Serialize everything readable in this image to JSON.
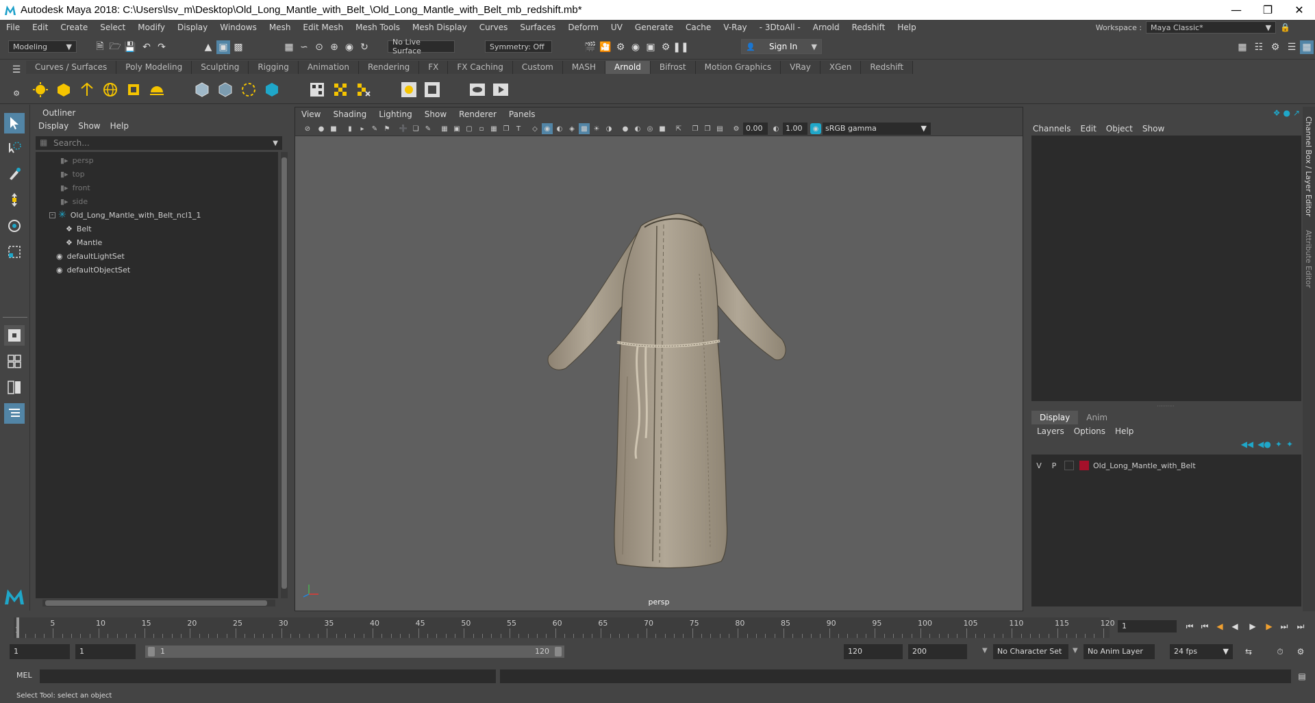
{
  "window": {
    "title": "Autodesk Maya 2018: C:\\Users\\lsv_m\\Desktop\\Old_Long_Mantle_with_Belt_\\Old_Long_Mantle_with_Belt_mb_redshift.mb*",
    "minimize_icon": "minimize-icon",
    "restore_icon": "restore-icon",
    "close_icon": "close-icon"
  },
  "menu": [
    "File",
    "Edit",
    "Create",
    "Select",
    "Modify",
    "Display",
    "Windows",
    "Mesh",
    "Edit Mesh",
    "Mesh Tools",
    "Mesh Display",
    "Curves",
    "Surfaces",
    "Deform",
    "UV",
    "Generate",
    "Cache",
    "V-Ray",
    "- 3DtoAll -",
    "Arnold",
    "Redshift",
    "Help"
  ],
  "workspace": {
    "label": "Workspace :",
    "value": "Maya Classic*"
  },
  "statusline": {
    "mode": "Modeling",
    "live_surface": "No Live Surface",
    "symmetry": "Symmetry: Off",
    "sign_in": "Sign In"
  },
  "shelf_tabs": [
    "Curves / Surfaces",
    "Poly Modeling",
    "Sculpting",
    "Rigging",
    "Animation",
    "Rendering",
    "FX",
    "FX Caching",
    "Custom",
    "MASH",
    "Arnold",
    "Bifrost",
    "Motion Graphics",
    "VRay",
    "XGen",
    "Redshift"
  ],
  "shelf_active": "Arnold",
  "outliner": {
    "title": "Outliner",
    "menu": [
      "Display",
      "Show",
      "Help"
    ],
    "search_placeholder": "Search...",
    "items": [
      {
        "label": "persp",
        "type": "camera",
        "dim": true
      },
      {
        "label": "top",
        "type": "camera",
        "dim": true
      },
      {
        "label": "front",
        "type": "camera",
        "dim": true
      },
      {
        "label": "side",
        "type": "camera",
        "dim": true
      },
      {
        "label": "Old_Long_Mantle_with_Belt_ncl1_1",
        "type": "group",
        "dim": false
      },
      {
        "label": "Belt",
        "type": "mesh",
        "dim": false
      },
      {
        "label": "Mantle",
        "type": "mesh",
        "dim": false
      },
      {
        "label": "defaultLightSet",
        "type": "set",
        "dim": false
      },
      {
        "label": "defaultObjectSet",
        "type": "set",
        "dim": false
      }
    ]
  },
  "viewport": {
    "menu": [
      "View",
      "Shading",
      "Lighting",
      "Show",
      "Renderer",
      "Panels"
    ],
    "exposure": "0.00",
    "gamma": "1.00",
    "colorspace": "sRGB gamma",
    "camera": "persp"
  },
  "channelbox": {
    "menu": [
      "Channels",
      "Edit",
      "Object",
      "Show"
    ],
    "layer_tabs": [
      "Display",
      "Anim"
    ],
    "layer_menu": [
      "Layers",
      "Options",
      "Help"
    ],
    "layer": {
      "v": "V",
      "p": "P",
      "name": "Old_Long_Mantle_with_Belt",
      "color": "#a5102a"
    }
  },
  "side_tabs": [
    "Channel Box / Layer Editor",
    "Attribute Editor"
  ],
  "timeline": {
    "ticks": [
      "5",
      "10",
      "15",
      "20",
      "25",
      "30",
      "35",
      "40",
      "45",
      "50",
      "55",
      "60",
      "65",
      "70",
      "75",
      "80",
      "85",
      "90",
      "95",
      "100",
      "105",
      "110",
      "115",
      "120"
    ],
    "start_tick": "1",
    "current_frame": "1"
  },
  "range": {
    "start": "1",
    "playback_start": "1",
    "slider_start": "1",
    "slider_end": "120",
    "playback_end": "120",
    "end": "200",
    "character_set": "No Character Set",
    "anim_layer": "No Anim Layer",
    "fps": "24 fps"
  },
  "cmdline": {
    "label": "MEL"
  },
  "helpline": {
    "text": "Select Tool: select an object"
  },
  "colors": {
    "bg": "#444444",
    "field": "#2b2b2b",
    "viewport": "#5f5f5f",
    "active_tool": "#5285a6",
    "accent": "#1fa7c9"
  }
}
